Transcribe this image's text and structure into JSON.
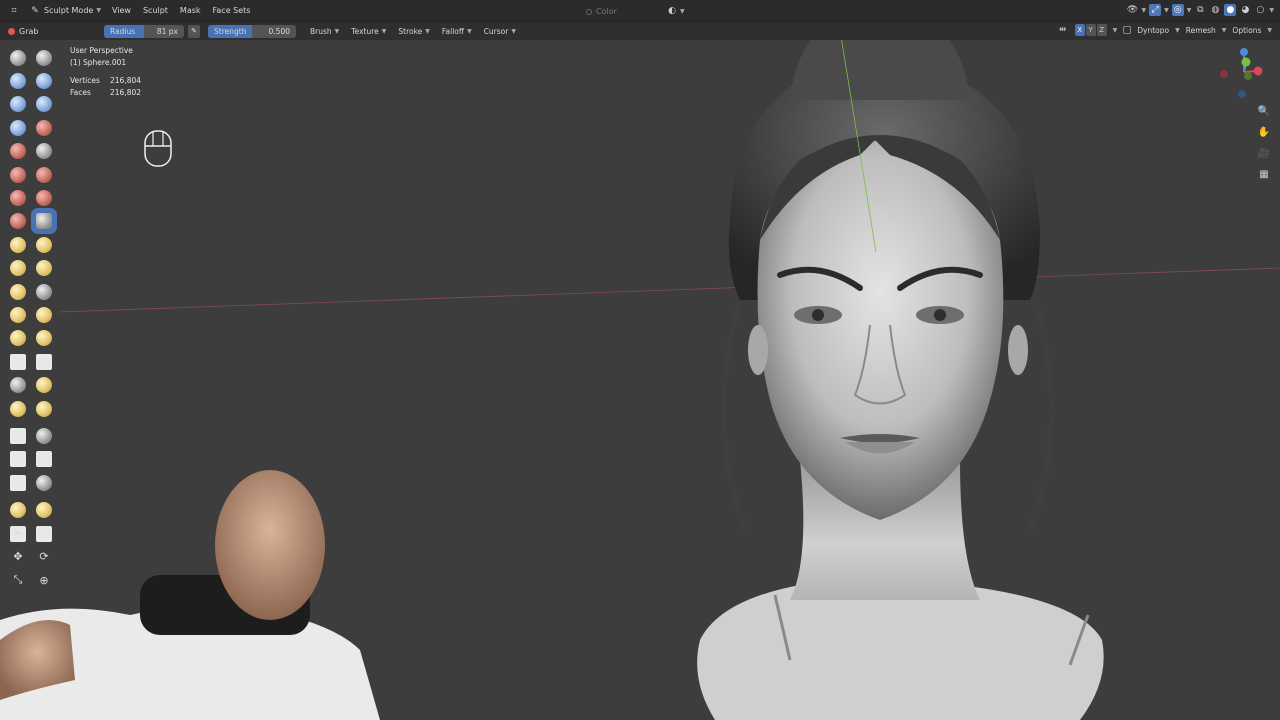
{
  "header": {
    "mode": "Sculpt Mode",
    "menus": [
      "View",
      "Sculpt",
      "Mask",
      "Face Sets"
    ],
    "color_label": "Color"
  },
  "tool_settings": {
    "tool_name": "Grab",
    "radius_label": "Radius",
    "radius_value": "81 px",
    "strength_label": "Strength",
    "strength_value": "0.500",
    "strength_fraction": 0.5,
    "dropdowns": [
      "Brush",
      "Texture",
      "Stroke",
      "Falloff",
      "Cursor"
    ],
    "symmetry_axes": [
      "X",
      "Y",
      "Z"
    ],
    "dyntopo_label": "Dyntopo",
    "remesh_label": "Remesh",
    "options_label": "Options"
  },
  "viewport": {
    "view_name": "User Perspective",
    "object_name": "(1) Sphere.001",
    "stats": [
      {
        "label": "Vertices",
        "value": "216,804"
      },
      {
        "label": "Faces",
        "value": "216,802"
      }
    ]
  },
  "left_toolbar_icons": [
    "draw-brush-icon",
    "draw-sharp-brush-icon",
    "clay-brush-icon",
    "clay-strips-brush-icon",
    "clay-thumb-brush-icon",
    "layer-brush-icon",
    "inflate-brush-icon",
    "blob-brush-icon",
    "crease-brush-icon",
    "smooth-brush-icon",
    "flatten-brush-icon",
    "fill-brush-icon",
    "scrape-brush-icon",
    "multiplane-scrape-brush-icon",
    "pinch-brush-icon",
    "grab-brush-icon",
    "elastic-deform-brush-icon",
    "snake-hook-brush-icon",
    "thumb-brush-icon",
    "pose-brush-icon",
    "nudge-brush-icon",
    "rotate-brush-icon",
    "slide-relax-brush-icon",
    "boundary-brush-icon",
    "cloth-brush-icon",
    "simplify-brush-icon",
    "mask-brush-icon",
    "draw-face-sets-icon",
    "multires-displacement-eraser-icon",
    "multires-displacement-smear-icon",
    "paint-brush-icon",
    "smear-brush-icon",
    "box-mask-icon",
    "box-hide-icon",
    "box-face-set-icon",
    "box-trim-icon",
    "line-project-icon",
    "mesh-filter-icon",
    "cloth-filter-icon",
    "color-filter-icon",
    "edit-face-set-icon",
    "mask-by-color-icon",
    "move-icon",
    "rotate-icon",
    "scale-icon",
    "transform-icon"
  ],
  "colors": {
    "header_bg": "#2b2b2b",
    "viewport_bg": "#3d3d3d",
    "accent": "#4772b3",
    "x_axis": "#d4495a",
    "y_axis": "#7fbf3f",
    "z_axis": "#4c8bd6"
  }
}
